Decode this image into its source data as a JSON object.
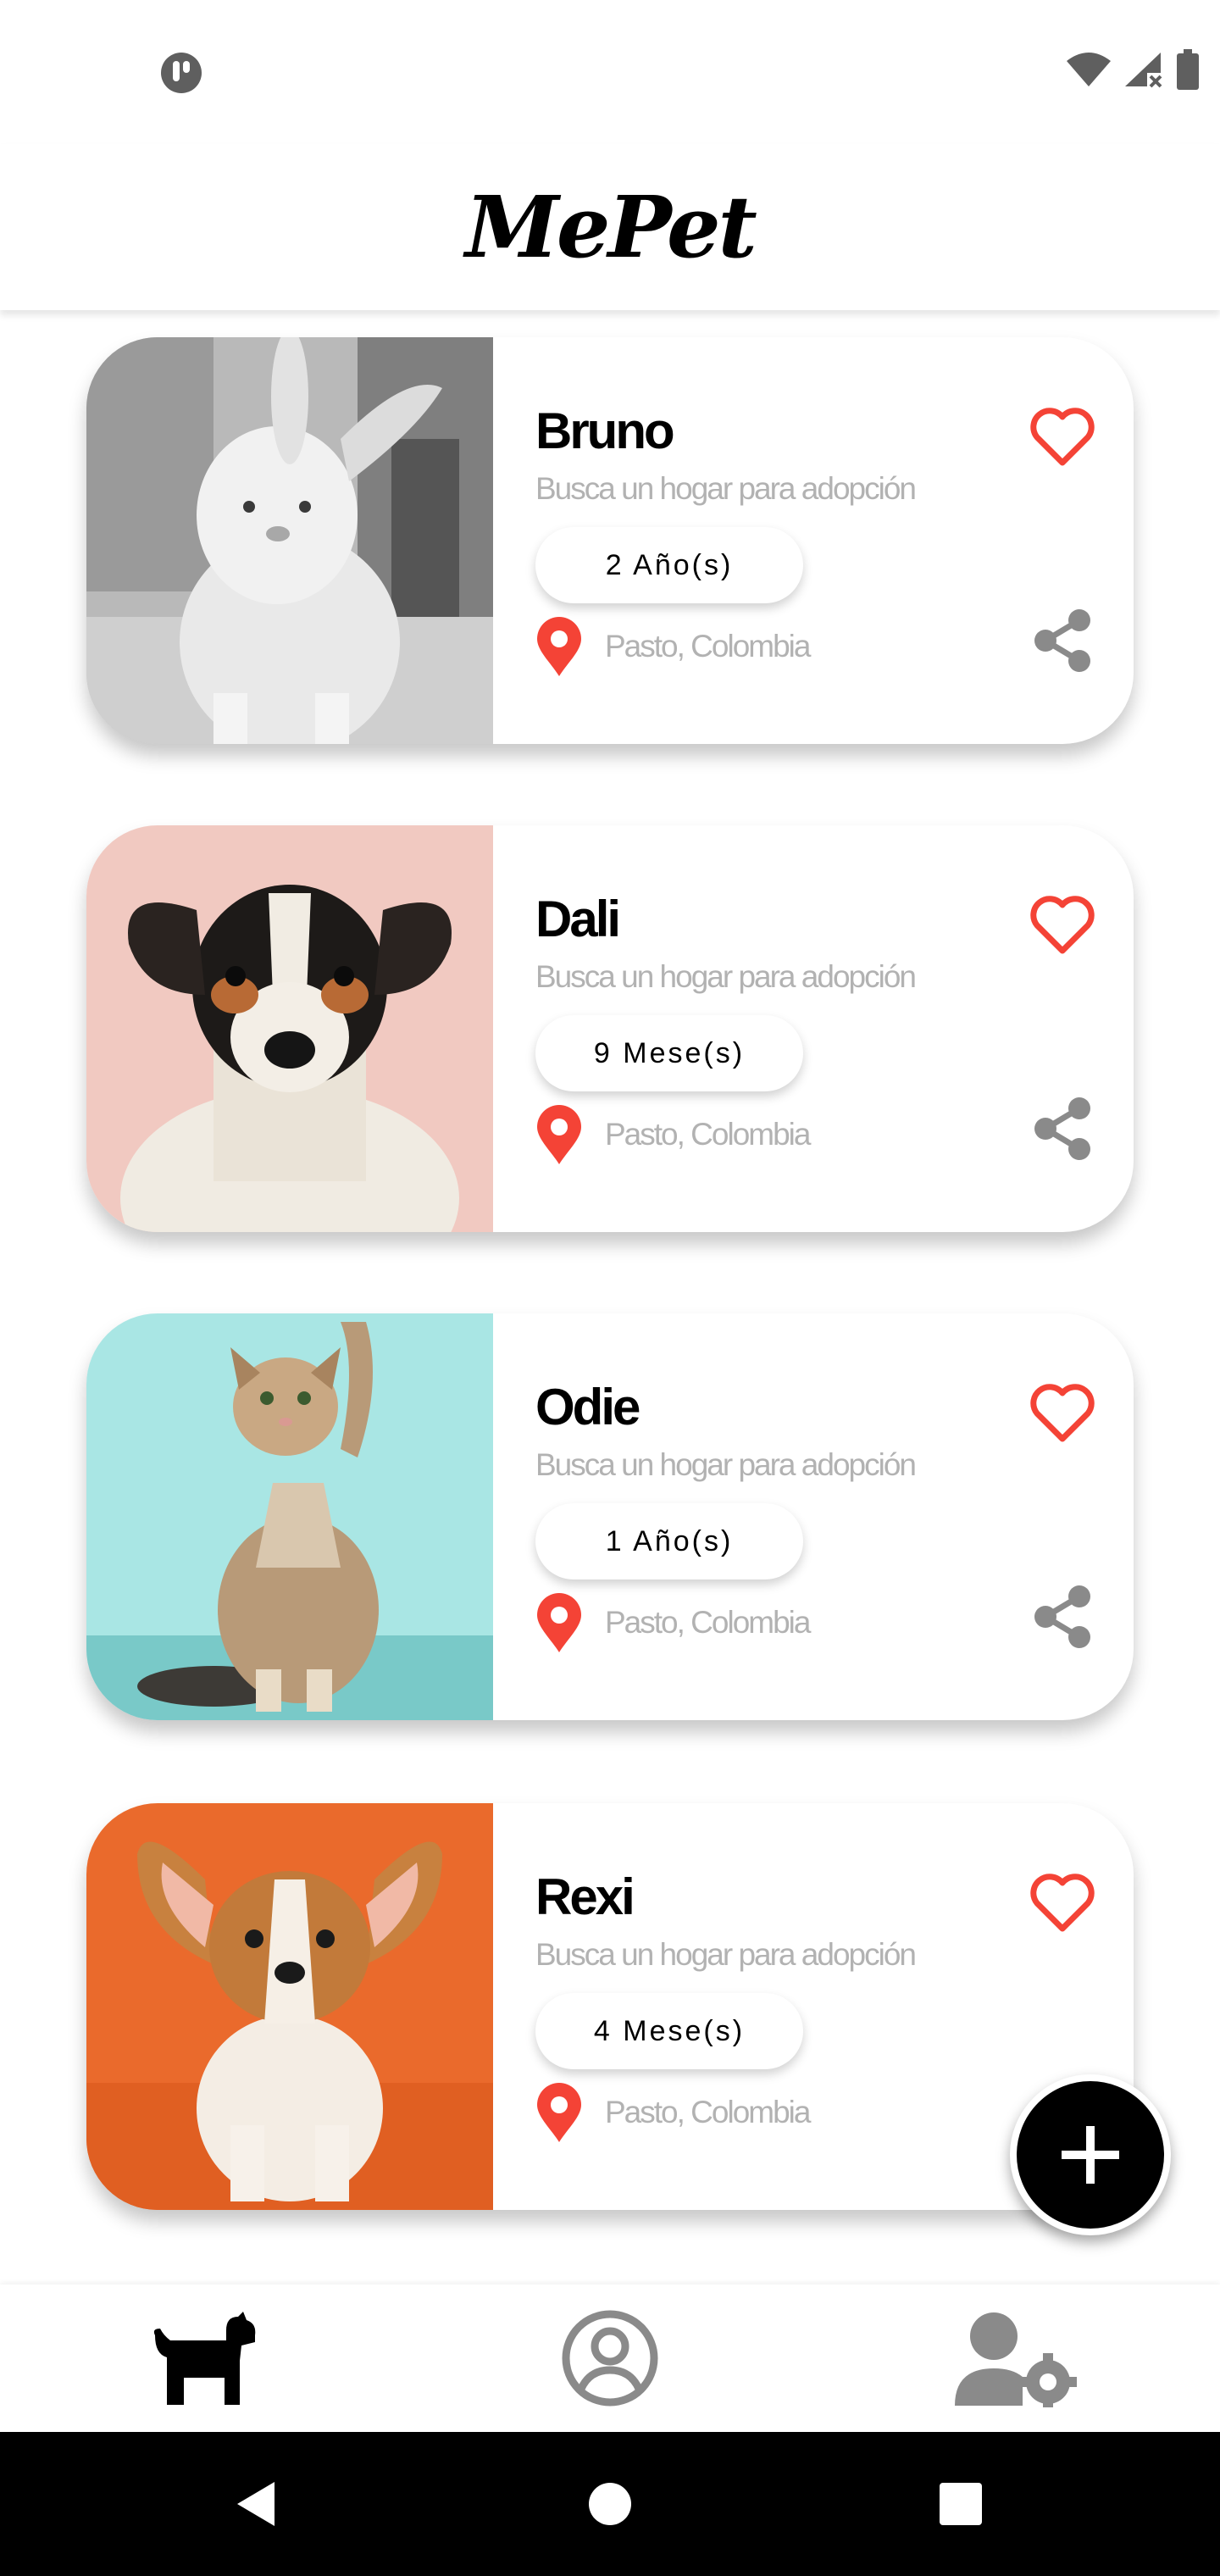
{
  "app": {
    "title": "MePet"
  },
  "status_bar": {
    "left_icon": "app-notification-icon",
    "right_icons": [
      "wifi-icon",
      "signal-no-data-icon",
      "battery-icon"
    ]
  },
  "pets": [
    {
      "name": "Bruno",
      "subtitle": "Busca un hogar para adopción",
      "age": "2 Año(s)",
      "location": "Pasto, Colombia",
      "photo": "white rabbit"
    },
    {
      "name": "Dali",
      "subtitle": "Busca un hogar para adopción",
      "age": "9 Mese(s)",
      "location": "Pasto, Colombia",
      "photo": "jack russell terrier dog"
    },
    {
      "name": "Odie",
      "subtitle": "Busca un hogar para adopción",
      "age": "1 Año(s)",
      "location": "Pasto, Colombia",
      "photo": "kitten reaching up"
    },
    {
      "name": "Rexi",
      "subtitle": "Busca un hogar para adopción",
      "age": "4 Mese(s)",
      "location": "Pasto, Colombia",
      "photo": "corgi puppy"
    }
  ],
  "fab": {
    "icon": "plus-icon"
  },
  "bottom_nav": {
    "items": [
      "dog-icon",
      "account-circle-icon",
      "user-settings-icon"
    ]
  },
  "system_nav": {
    "items": [
      "back-icon",
      "home-icon",
      "recents-icon"
    ]
  },
  "colors": {
    "accent": "#f44336",
    "muted_text": "#b2b2b2",
    "icon_gray": "#8a8a8a",
    "primary": "#000000"
  }
}
